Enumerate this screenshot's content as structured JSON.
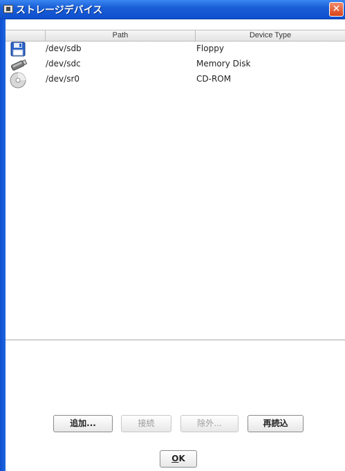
{
  "window": {
    "title": "ストレージデバイス",
    "close_label": "✕"
  },
  "table": {
    "columns": [
      "",
      "Path",
      "Device Type"
    ],
    "rows": [
      {
        "icon": "floppy-disk-icon",
        "path": "/dev/sdb",
        "type": "Floppy"
      },
      {
        "icon": "usb-drive-icon",
        "path": "/dev/sdc",
        "type": "Memory Disk"
      },
      {
        "icon": "cd-rom-icon",
        "path": "/dev/sr0",
        "type": "CD-ROM"
      }
    ]
  },
  "buttons": {
    "add": "追加...",
    "connect": "接続",
    "remove": "除外...",
    "reload": "再読込",
    "ok_prefix": "O",
    "ok_suffix": "K"
  },
  "colors": {
    "titlebar": "#1a5fd6",
    "close": "#d8431a"
  }
}
